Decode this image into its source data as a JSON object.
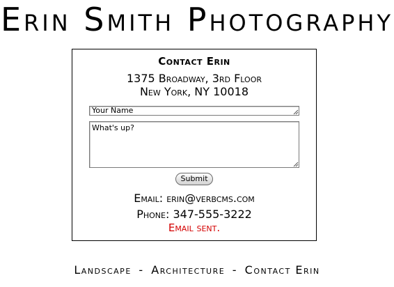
{
  "site": {
    "title": "Erin Smith Photography"
  },
  "contact": {
    "heading": "Contact Erin",
    "address_line1": "1375 Broadway, 3rd Floor",
    "address_line2": "New York, NY 10018",
    "form": {
      "name_value": "Your Name",
      "message_value": "What's up?",
      "submit_label": "Submit"
    },
    "email_label": "Email:",
    "email_value": "erin@verbcms.com",
    "phone_label": "Phone:",
    "phone_value": "347-555-3222",
    "status": "Email sent.",
    "status_color": "#d40000"
  },
  "footer": {
    "nav": [
      {
        "label": "Landscape"
      },
      {
        "label": "Architecture"
      },
      {
        "label": "Contact Erin"
      }
    ],
    "separator": "-"
  }
}
